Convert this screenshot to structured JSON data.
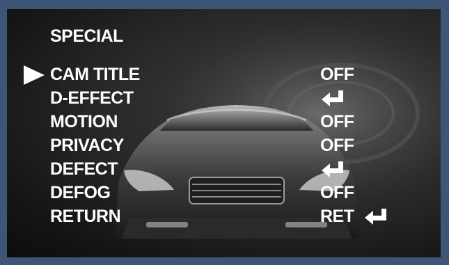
{
  "menu": {
    "title": "SPECIAL",
    "items": [
      {
        "label": "CAM TITLE",
        "value": "OFF",
        "value_icon": null,
        "selected": true
      },
      {
        "label": "D-EFFECT",
        "value": "",
        "value_icon": "enter-icon",
        "selected": false
      },
      {
        "label": "MOTION",
        "value": "OFF",
        "value_icon": null,
        "selected": false
      },
      {
        "label": "PRIVACY",
        "value": "OFF",
        "value_icon": null,
        "selected": false
      },
      {
        "label": "DEFECT",
        "value": "",
        "value_icon": "enter-icon",
        "selected": false
      },
      {
        "label": "DEFOG",
        "value": "OFF",
        "value_icon": null,
        "selected": false
      },
      {
        "label": "RETURN",
        "value": "RET",
        "value_icon": "enter-icon",
        "selected": false
      }
    ]
  },
  "colors": {
    "frame": "#3e5578",
    "text": "#ffffff"
  }
}
